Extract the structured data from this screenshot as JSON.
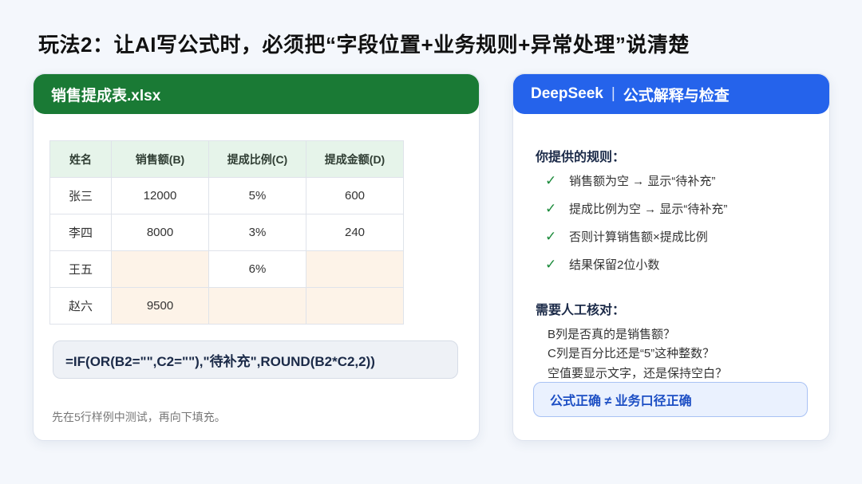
{
  "page": {
    "title": "玩法2：让AI写公式时，必须把“字段位置+业务规则+异常处理”说清楚"
  },
  "sheet": {
    "filename": "销售提成表.xlsx",
    "headers": [
      "姓名",
      "销售额(B)",
      "提成比例(C)",
      "提成金额(D)"
    ],
    "rows": [
      [
        "张三",
        "12000",
        "5%",
        "600"
      ],
      [
        "李四",
        "8000",
        "3%",
        "240"
      ],
      [
        "王五",
        "",
        "6%",
        ""
      ],
      [
        "赵六",
        "9500",
        "",
        ""
      ]
    ],
    "formula": "=IF(OR(B2=\"\",C2=\"\"),\"待补充\",ROUND(B2*C2,2))",
    "note": "先在5行样例中测试，再向下填充。"
  },
  "assistant": {
    "brand": "DeepSeek",
    "separator": "|",
    "title": "公式解释与检查",
    "rules_title": "你提供的规则：",
    "rules": [
      "销售额为空 → 显示“待补充”",
      "提成比例为空 → 显示“待补充”",
      "否则计算销售额×提成比例",
      "结果保留2位小数"
    ],
    "check_icon": "✓",
    "review_title": "需要人工核对：",
    "review_items": [
      "B列是否真的是销售额？",
      "C列是百分比还是“5”这种整数？",
      "空值要显示文字，还是保持空白？"
    ],
    "conclusion": "公式正确 ≠ 业务口径正确"
  },
  "colors": {
    "sheet_header": "#1a7a35",
    "assistant_header": "#2563eb",
    "missing_cell": "#fdf3e8",
    "check": "#1a8a3a"
  }
}
